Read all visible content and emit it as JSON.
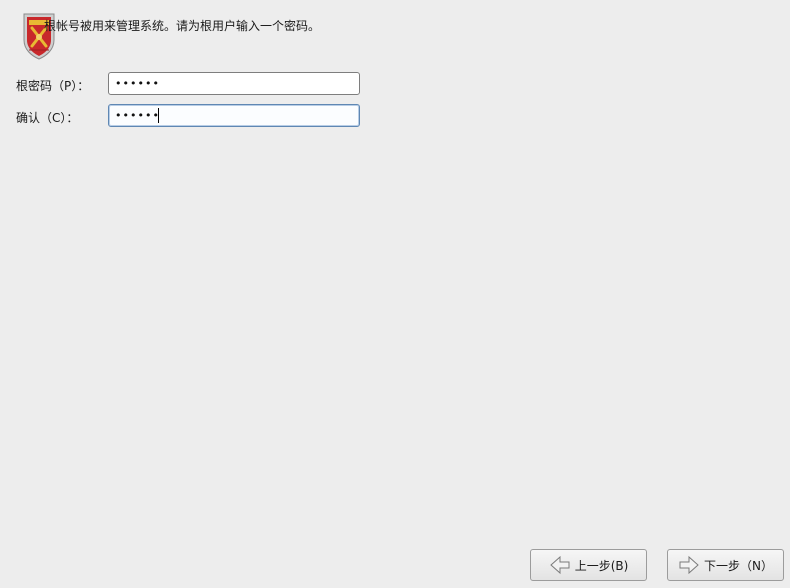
{
  "header": {
    "logo_icon": "shield-logo-icon",
    "message": "根帐号被用来管理系统。请为根用户输入一个密码。"
  },
  "form": {
    "password_label": "根密码（P）：",
    "password_value": "••••••",
    "confirm_label": "确认（C）：",
    "confirm_value": "••••••"
  },
  "nav": {
    "back_label": "上一步(B)",
    "back_icon": "arrow-left-icon",
    "next_label": "下一步（N）",
    "next_icon": "arrow-right-icon"
  },
  "colors": {
    "background": "#ededed",
    "focus_border": "#5f87b3",
    "shield_red": "#c8282b",
    "shield_gold": "#e8b933"
  }
}
